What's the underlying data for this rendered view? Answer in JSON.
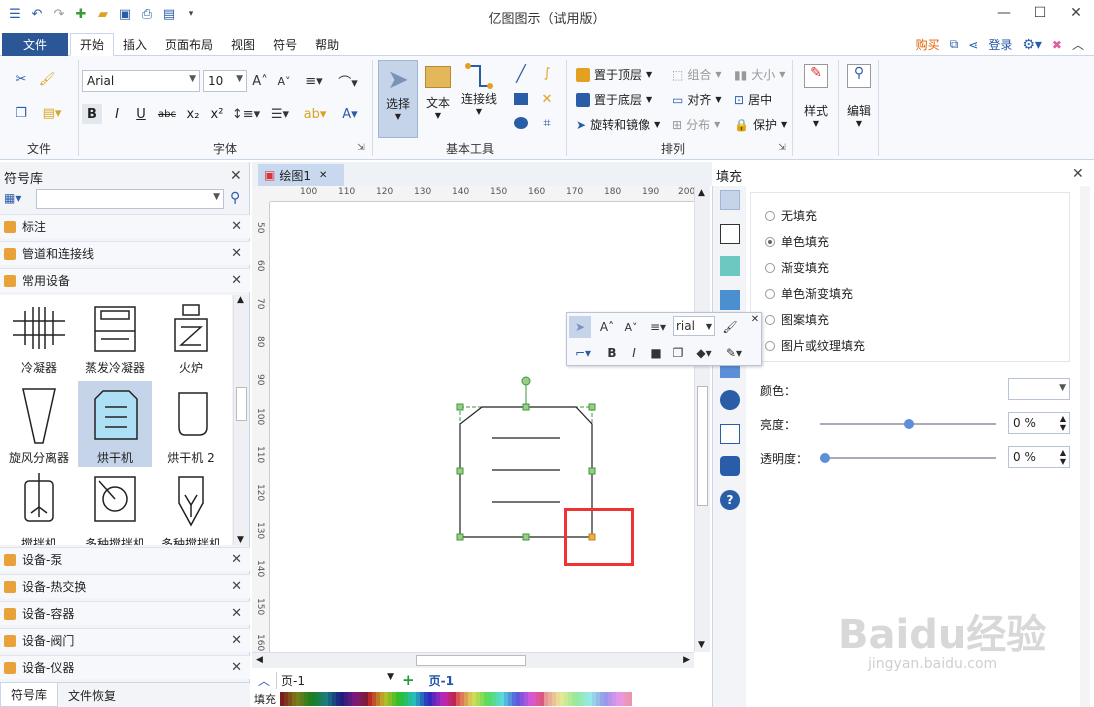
{
  "window": {
    "title": "亿图图示（试用版）"
  },
  "menu": {
    "file_label": "文件",
    "tabs": [
      "开始",
      "插入",
      "页面布局",
      "视图",
      "符号",
      "帮助"
    ],
    "buy_label": "购买",
    "login_label": "登录"
  },
  "ribbon": {
    "font_name": "Arial",
    "font_size": "10",
    "groups": {
      "file": "文件",
      "font": "字体",
      "basic_tools": "基本工具",
      "arrange": "排列"
    },
    "tools": {
      "select": "选择",
      "text": "文本",
      "connector": "连接线"
    },
    "arrange": {
      "bring_front": "置于顶层",
      "send_back": "置于底层",
      "rotate": "旋转和镜像",
      "group": "组合",
      "align": "对齐",
      "distribute": "分布",
      "size": "大小",
      "center": "居中",
      "protect": "保护"
    },
    "style_label": "样式",
    "edit_label": "编辑"
  },
  "library": {
    "title": "符号库",
    "open_groups": [
      "标注",
      "管道和连接线",
      "常用设备"
    ],
    "shapes": [
      {
        "label": "冷凝器"
      },
      {
        "label": "蒸发冷凝器"
      },
      {
        "label": "火炉"
      },
      {
        "label": "旋风分离器"
      },
      {
        "label": "烘干机"
      },
      {
        "label": "烘干机 2"
      },
      {
        "label": "搅拌机"
      },
      {
        "label": "多种搅拌机"
      },
      {
        "label": "多种搅拌机"
      }
    ],
    "closed_groups": [
      "设备-泵",
      "设备-热交换",
      "设备-容器",
      "设备-阀门",
      "设备-仪器"
    ],
    "bottom_tabs": [
      "符号库",
      "文件恢复"
    ]
  },
  "document": {
    "tab_label": "绘图1",
    "ruler_h": [
      "100",
      "110",
      "120",
      "130",
      "140",
      "150",
      "160",
      "170",
      "180",
      "190",
      "200"
    ],
    "ruler_v": [
      "50",
      "60",
      "70",
      "80",
      "90",
      "100",
      "110",
      "120",
      "130",
      "140",
      "150",
      "160"
    ],
    "page_select": "页-1",
    "page_tab": "页-1",
    "fill_label": "填充"
  },
  "floatbar": {
    "font_name": "rial"
  },
  "fill_panel": {
    "title": "填充",
    "options": [
      "无填充",
      "单色填充",
      "渐变填充",
      "单色渐变填充",
      "图案填充",
      "图片或纹理填充"
    ],
    "selected_index": 1,
    "color_label": "颜色：",
    "brightness_label": "亮度：",
    "brightness_value": "0 %",
    "transparency_label": "透明度：",
    "transparency_value": "0 %"
  },
  "watermark": {
    "main": "Baidu经验",
    "sub": "jingyan.baidu.com"
  },
  "colors": {
    "accent": "#2b5797",
    "highlight": "#ee3333",
    "selected_shape": "#c6d4ea"
  }
}
